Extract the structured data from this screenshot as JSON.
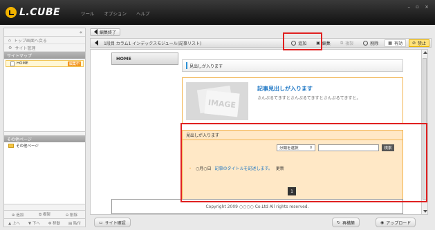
{
  "app": {
    "logo": "L.CUBE",
    "menus": [
      "ツール",
      "オプション",
      "ヘルプ"
    ],
    "window_controls": "– ▫ ×"
  },
  "left": {
    "collapse": "«",
    "links": [
      {
        "icon": "house-icon",
        "label": "トップ画面へ戻る"
      },
      {
        "icon": "gear-icon",
        "label": "サイト管理"
      }
    ],
    "sitemap_header": "サイトマップ",
    "sitemap_items": [
      {
        "label": "HOME",
        "badge": "編集中"
      }
    ],
    "other_header": "その他ページ",
    "other_items": [
      {
        "label": "その他ページ"
      }
    ],
    "bottom_row1": [
      "追加",
      "複製",
      "削除"
    ],
    "bottom_row2": [
      "上へ",
      "下へ",
      "移動",
      "貼付"
    ]
  },
  "toolbar": {
    "edit_end": "編集終了",
    "path": "1段目 カラム1 インデックスモジュール(記事リスト)",
    "actions": [
      {
        "icon": "plus-icon",
        "label": "追加",
        "state": "normal"
      },
      {
        "icon": "edit-icon",
        "label": "編集",
        "state": "normal"
      },
      {
        "icon": "copy-icon",
        "label": "複製",
        "state": "disabled"
      },
      {
        "icon": "minus-icon",
        "label": "削除",
        "state": "normal"
      },
      {
        "icon": "check-icon",
        "label": "有効",
        "state": "normal"
      },
      {
        "icon": "stop-icon",
        "label": "禁止",
        "state": "active"
      }
    ]
  },
  "canvas": {
    "home_tab": "HOME",
    "heading1": "見出しが入ります",
    "image_label": "IMAGE",
    "article_title": "記事見出しが入ります",
    "article_body": "さんぷるてきすとさんぷるてきすとさんぷるてきすと。",
    "list_heading": "見出しが入ります",
    "category_select": "分類を選択",
    "search_button": "検索",
    "entry_dot": "・",
    "entry_date": "○月○日",
    "entry_title": "記事のタイトルを記述します。",
    "entry_update": "更新",
    "page_number": "1",
    "footer": "Copyright 2009 ○○○○ Co.Ltd All rights reserved."
  },
  "bottom": {
    "site_check": "サイト確認",
    "rebuild": "再構築",
    "upload": "アップロード"
  },
  "colors": {
    "accent_orange": "#f2b450",
    "link_blue": "#1c76c4",
    "annotation_red": "#e02020"
  }
}
